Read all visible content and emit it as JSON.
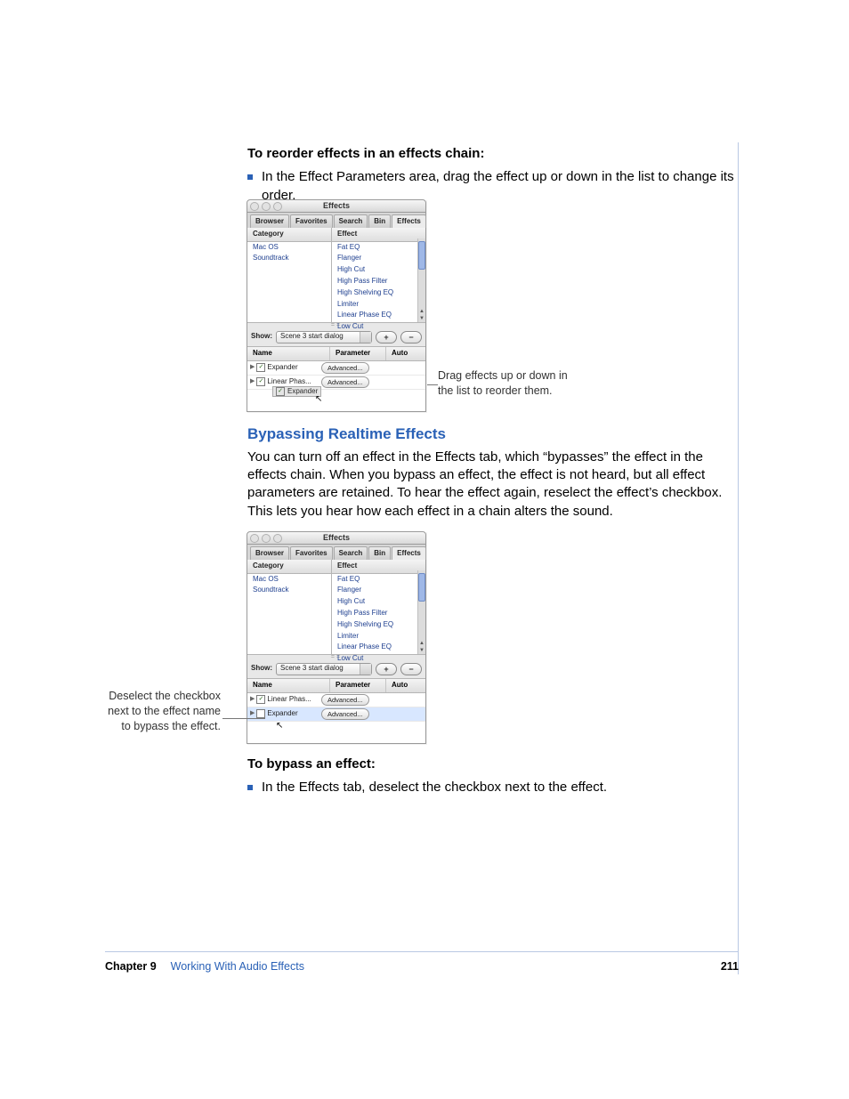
{
  "section1": {
    "heading": "To reorder effects in an effects chain:",
    "bullet": "In the Effect Parameters area, drag the effect up or down in the list to change its order."
  },
  "callouts": {
    "drag": "Drag effects up or down in the list to reorder them.",
    "deselect": "Deselect the checkbox next to the effect name to bypass the effect."
  },
  "section2": {
    "heading": "Bypassing Realtime Effects",
    "body": "You can turn off an effect in the Effects tab, which “bypasses” the effect in the effects chain. When you bypass an effect, the effect is not heard, but all effect parameters are retained. To hear the effect again, reselect the effect’s checkbox. This lets you hear how each effect in a chain alters the sound."
  },
  "section3": {
    "heading": "To bypass an effect:",
    "bullet": "In the Effects tab, deselect the checkbox next to the effect."
  },
  "shot": {
    "window_title": "Effects",
    "tabs": [
      "Browser",
      "Favorites",
      "Search",
      "Bin",
      "Effects"
    ],
    "col_category": "Category",
    "col_effect": "Effect",
    "categories": [
      "Mac OS",
      "Soundtrack"
    ],
    "effects": [
      "Fat EQ",
      "Flanger",
      "High Cut",
      "High Pass Filter",
      "High Shelving EQ",
      "Limiter",
      "Linear Phase EQ",
      "Low Cut"
    ],
    "show_label": "Show:",
    "show_value": "Scene 3 start dialog",
    "plus": "+",
    "minus": "−",
    "hdr_name": "Name",
    "hdr_param": "Parameter",
    "hdr_auto": "Auto",
    "advanced": "Advanced...",
    "rows_a": [
      {
        "name": "Expander",
        "checked": true
      },
      {
        "name": "Linear Phas...",
        "checked": true
      }
    ],
    "ghost_a": "Expander",
    "rows_b": [
      {
        "name": "Linear Phas...",
        "checked": true
      },
      {
        "name": "Expander",
        "checked": false
      }
    ]
  },
  "footer": {
    "chapter": "Chapter 9",
    "title": "Working With Audio Effects",
    "page": "211"
  }
}
